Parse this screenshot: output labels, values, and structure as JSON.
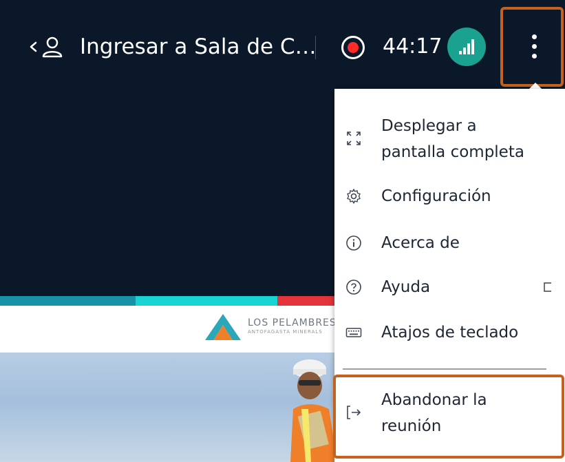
{
  "header": {
    "room_title": "Ingresar a Sala de C…",
    "timer": "44:17"
  },
  "menu": {
    "items": [
      {
        "label_line1": "Desplegar a",
        "label_line2": "pantalla completa",
        "icon": "fullscreen-icon"
      },
      {
        "label": "Configuración",
        "icon": "gear-icon"
      },
      {
        "label": "Acerca de",
        "icon": "info-icon"
      },
      {
        "label": "Ayuda",
        "icon": "help-icon"
      },
      {
        "label": "Atajos de teclado",
        "icon": "keyboard-icon"
      }
    ],
    "leave": {
      "label_line1": "Abandonar la",
      "label_line2": "reunión",
      "icon": "leave-icon"
    }
  },
  "content": {
    "brand_name": "LOS PELAMBRES",
    "brand_sub": "ANTOFAGASTA MINERALS"
  },
  "colors": {
    "topbar": "#0b1829",
    "accent_green": "#1aa190",
    "record_red": "#ff2b2b",
    "highlight_orange": "#c3621f",
    "stripe_blue": "#1792a6",
    "stripe_cyan": "#17d3d2",
    "stripe_red": "#e2343a"
  }
}
